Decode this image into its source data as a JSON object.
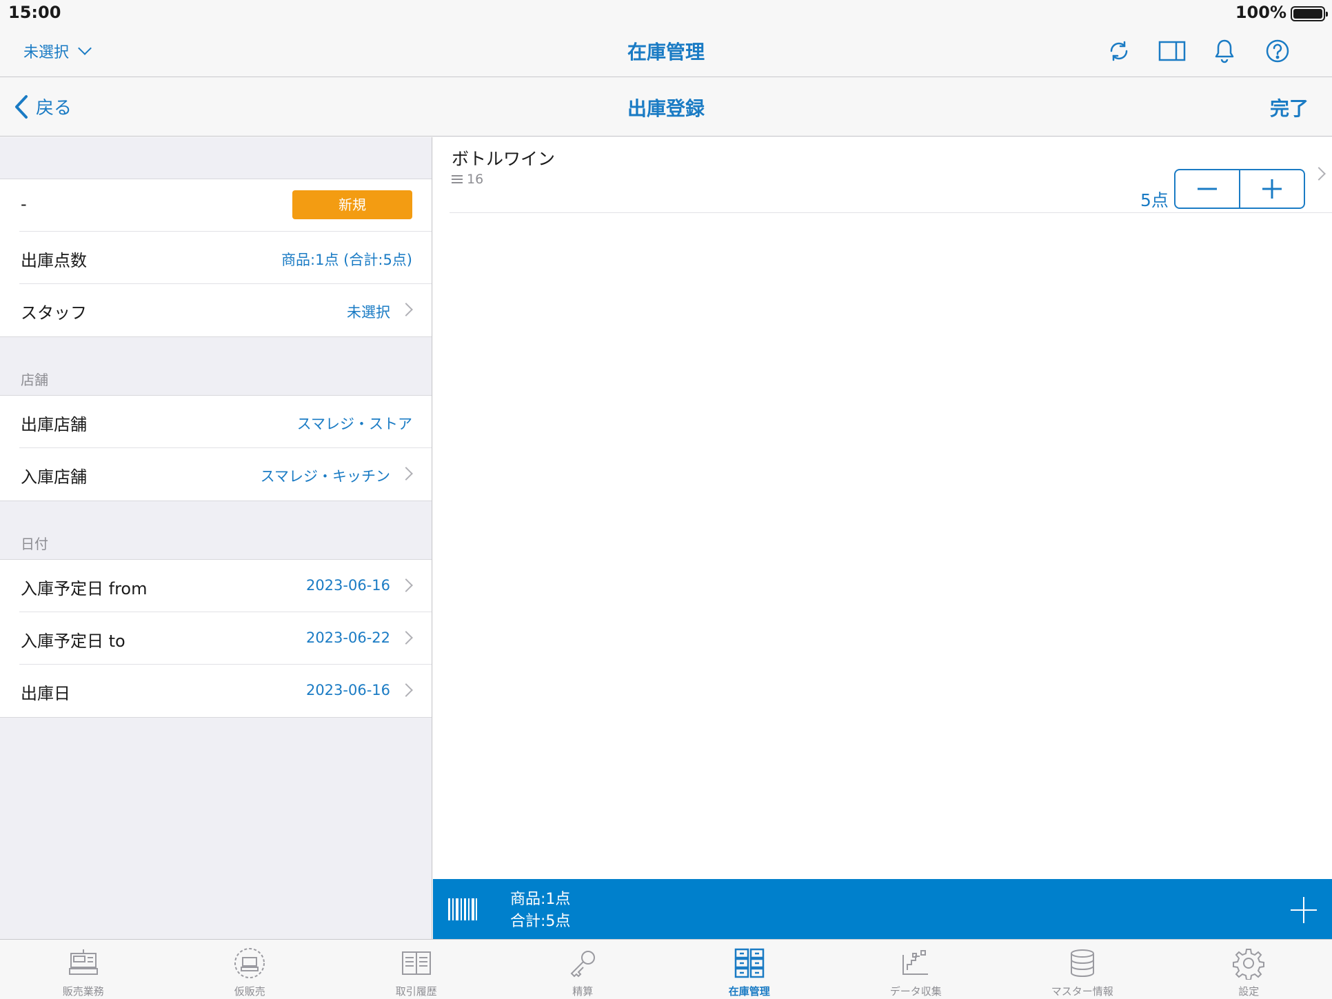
{
  "status_bar": {
    "time": "15:00",
    "battery": "100%"
  },
  "app_header": {
    "store_select": "未選択",
    "title": "在庫管理",
    "icons": [
      "refresh-icon",
      "split-view-icon",
      "bell-icon",
      "help-icon"
    ]
  },
  "nav": {
    "back_label": "戻る",
    "title": "出庫登録",
    "done_label": "完了"
  },
  "left": {
    "summary": {
      "status_text": "-",
      "status_badge": "新規",
      "count_label": "出庫点数",
      "count_value": "商品:1点 (合計:5点)",
      "staff_label": "スタッフ",
      "staff_value": "未選択"
    },
    "store_section": {
      "header": "店舗",
      "out_store_label": "出庫店舗",
      "out_store_value": "スマレジ・ストア",
      "in_store_label": "入庫店舗",
      "in_store_value": "スマレジ・キッチン"
    },
    "date_section": {
      "header": "日付",
      "from_label": "入庫予定日 from",
      "from_value": "2023-06-16",
      "to_label": "入庫予定日 to",
      "to_value": "2023-06-22",
      "ship_label": "出庫日",
      "ship_value": "2023-06-16"
    }
  },
  "items": [
    {
      "name": "ボトルワイン",
      "code": "16",
      "qty": "5点"
    }
  ],
  "summary_bar": {
    "line1": "商品:1点",
    "line2": "合計:5点"
  },
  "tabs": [
    {
      "label": "販売業務",
      "icon": "register-icon"
    },
    {
      "label": "仮販売",
      "icon": "temp-sale-icon"
    },
    {
      "label": "取引履歴",
      "icon": "history-icon"
    },
    {
      "label": "精算",
      "icon": "key-icon"
    },
    {
      "label": "在庫管理",
      "icon": "inventory-icon",
      "active": true
    },
    {
      "label": "データ収集",
      "icon": "data-collection-icon"
    },
    {
      "label": "マスター情報",
      "icon": "database-icon"
    },
    {
      "label": "設定",
      "icon": "gear-icon"
    }
  ],
  "colors": {
    "accent": "#1a7bc4",
    "badge": "#f39c12",
    "summary_bar": "#0080cc"
  }
}
